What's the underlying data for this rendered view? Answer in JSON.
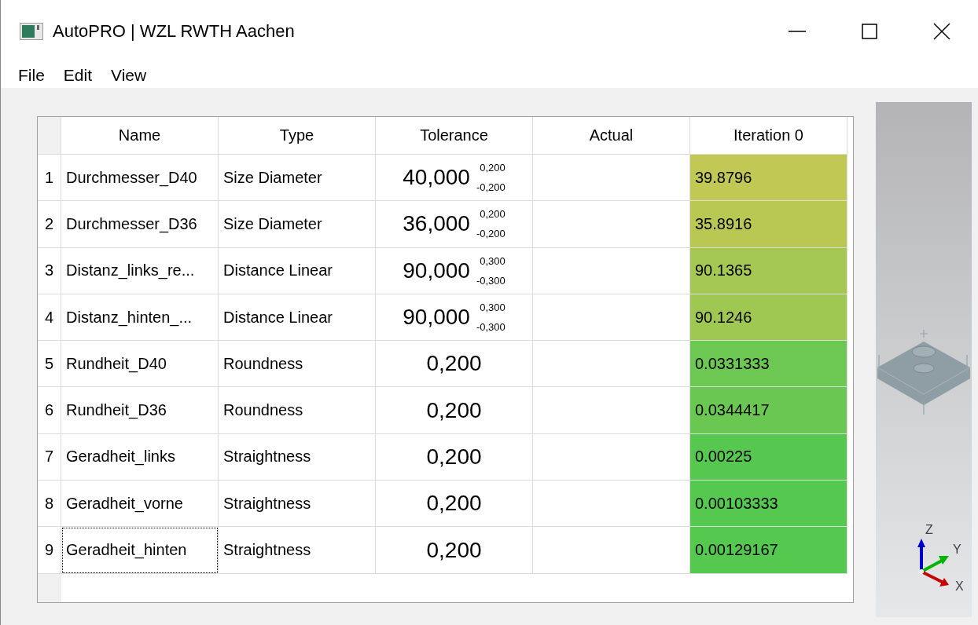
{
  "window": {
    "title": "AutoPRO | WZL RWTH Aachen"
  },
  "menu": [
    "File",
    "Edit",
    "View"
  ],
  "table": {
    "columns": [
      "Name",
      "Type",
      "Tolerance",
      "Actual",
      "Iteration 0"
    ],
    "rows": [
      {
        "index": "1",
        "name": "Durchmesser_D40",
        "type": "Size Diameter",
        "nominal": "40,000",
        "upper": "0,200",
        "lower": "-0,200",
        "iteration": "39.8796",
        "color": "#c1c853",
        "focused": false
      },
      {
        "index": "2",
        "name": "Durchmesser_D36",
        "type": "Size Diameter",
        "nominal": "36,000",
        "upper": "0,200",
        "lower": "-0,200",
        "iteration": "35.8916",
        "color": "#b9c753",
        "focused": false
      },
      {
        "index": "3",
        "name": "Distanz_links_re...",
        "type": "Distance Linear",
        "nominal": "90,000",
        "upper": "0,300",
        "lower": "-0,300",
        "iteration": "90.1365",
        "color": "#a4c853",
        "focused": false
      },
      {
        "index": "4",
        "name": "Distanz_hinten_...",
        "type": "Distance Linear",
        "nominal": "90,000",
        "upper": "0,300",
        "lower": "-0,300",
        "iteration": "90.1246",
        "color": "#9fc853",
        "focused": false
      },
      {
        "index": "5",
        "name": "Rundheit_D40",
        "type": "Roundness",
        "nominal": "0,200",
        "iteration": "0.0331333",
        "color": "#6cc852",
        "focused": false
      },
      {
        "index": "6",
        "name": "Rundheit_D36",
        "type": "Roundness",
        "nominal": "0,200",
        "iteration": "0.0344417",
        "color": "#69c752",
        "focused": false
      },
      {
        "index": "7",
        "name": "Geradheit_links",
        "type": "Straightness",
        "nominal": "0,200",
        "iteration": "0.00225",
        "color": "#56c850",
        "focused": false
      },
      {
        "index": "8",
        "name": "Geradheit_vorne",
        "type": "Straightness",
        "nominal": "0,200",
        "iteration": "0.00103333",
        "color": "#55c850",
        "focused": false
      },
      {
        "index": "9",
        "name": "Geradheit_hinten",
        "type": "Straightness",
        "nominal": "0,200",
        "iteration": "0.00129167",
        "color": "#55c850",
        "focused": true
      }
    ]
  },
  "viewport": {
    "axis_labels": [
      "Z",
      "Y",
      "X"
    ]
  }
}
